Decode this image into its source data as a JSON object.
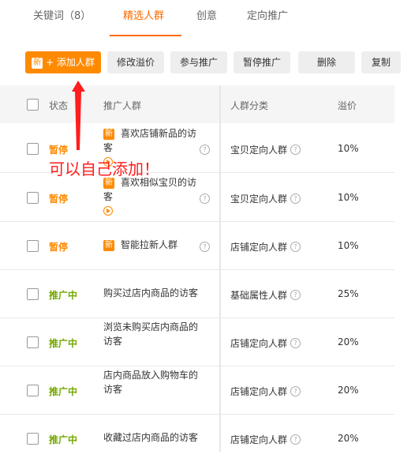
{
  "tabs": {
    "keywords": "关键词（8）",
    "selected_audience": "精选人群",
    "creative": "创意",
    "targeting": "定向推广"
  },
  "toolbar": {
    "new_badge": "新",
    "add_audience": "+ 添加人群",
    "edit_premium": "修改溢价",
    "join_promotion": "参与推广",
    "pause_promotion": "暂停推广",
    "delete": "删除",
    "copy": "复制"
  },
  "table": {
    "headers": {
      "status": "状态",
      "audience": "推广人群",
      "category": "人群分类",
      "premium": "溢价"
    },
    "rows": [
      {
        "status": "暂停",
        "tag": "新",
        "name": "喜欢店铺新品的访客",
        "category": "宝贝定向人群",
        "rate": "10%"
      },
      {
        "status": "暂停",
        "tag": "新",
        "name": "喜欢相似宝贝的访客",
        "category": "宝贝定向人群",
        "rate": "10%"
      },
      {
        "status": "暂停",
        "tag": "新",
        "name": "智能拉新人群",
        "category": "店铺定向人群",
        "rate": "10%"
      },
      {
        "status": "推广中",
        "tag": "",
        "name": "购买过店内商品的访客",
        "category": "基础属性人群",
        "rate": "25%"
      },
      {
        "status": "推广中",
        "tag": "",
        "name": "浏览未购买店内商品的访客",
        "category": "店铺定向人群",
        "rate": "20%"
      },
      {
        "status": "推广中",
        "tag": "",
        "name": "店内商品放入购物车的访客",
        "category": "店铺定向人群",
        "rate": "20%"
      },
      {
        "status": "推广中",
        "tag": "",
        "name": "收藏过店内商品的访客",
        "category": "店铺定向人群",
        "rate": "20%"
      }
    ]
  },
  "annotation": "可以自己添加！",
  "colors": {
    "accent": "#ff6a00",
    "primary_button": "#ff8a00",
    "status_paused": "#ff8a00",
    "status_active": "#74a800",
    "annotation": "#ff1d1d"
  }
}
